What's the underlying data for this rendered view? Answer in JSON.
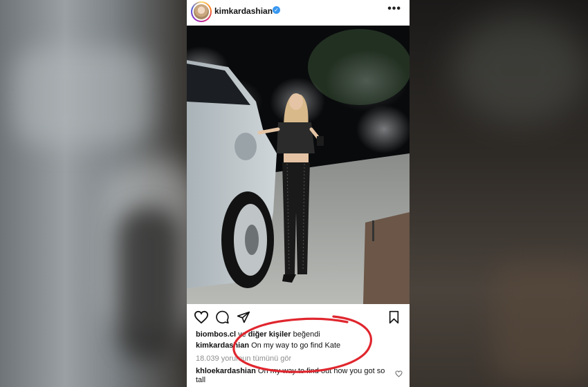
{
  "post": {
    "username": "kimkardashian",
    "verified_icon": "verified-badge-icon",
    "more_icon": "more-options-icon",
    "likes": {
      "user": "biombos.cl",
      "joiner": " ve ",
      "others": "diğer kişiler",
      "suffix": " beğendi"
    },
    "caption": {
      "user": "kimkardashian",
      "text": " On my way to go find Kate"
    },
    "comments_link": "18.039 yorumun tümünü gör",
    "comment": {
      "user": "khloekardashian",
      "text": " On my way to find out how you got so tall"
    },
    "actions": [
      "heart-icon",
      "comment-icon",
      "share-icon",
      "bookmark-icon"
    ]
  },
  "colors": {
    "username": "#111111",
    "verified": "#3897f0",
    "secondary_text": "#8e8e8e",
    "annotation": "#e0262e"
  }
}
